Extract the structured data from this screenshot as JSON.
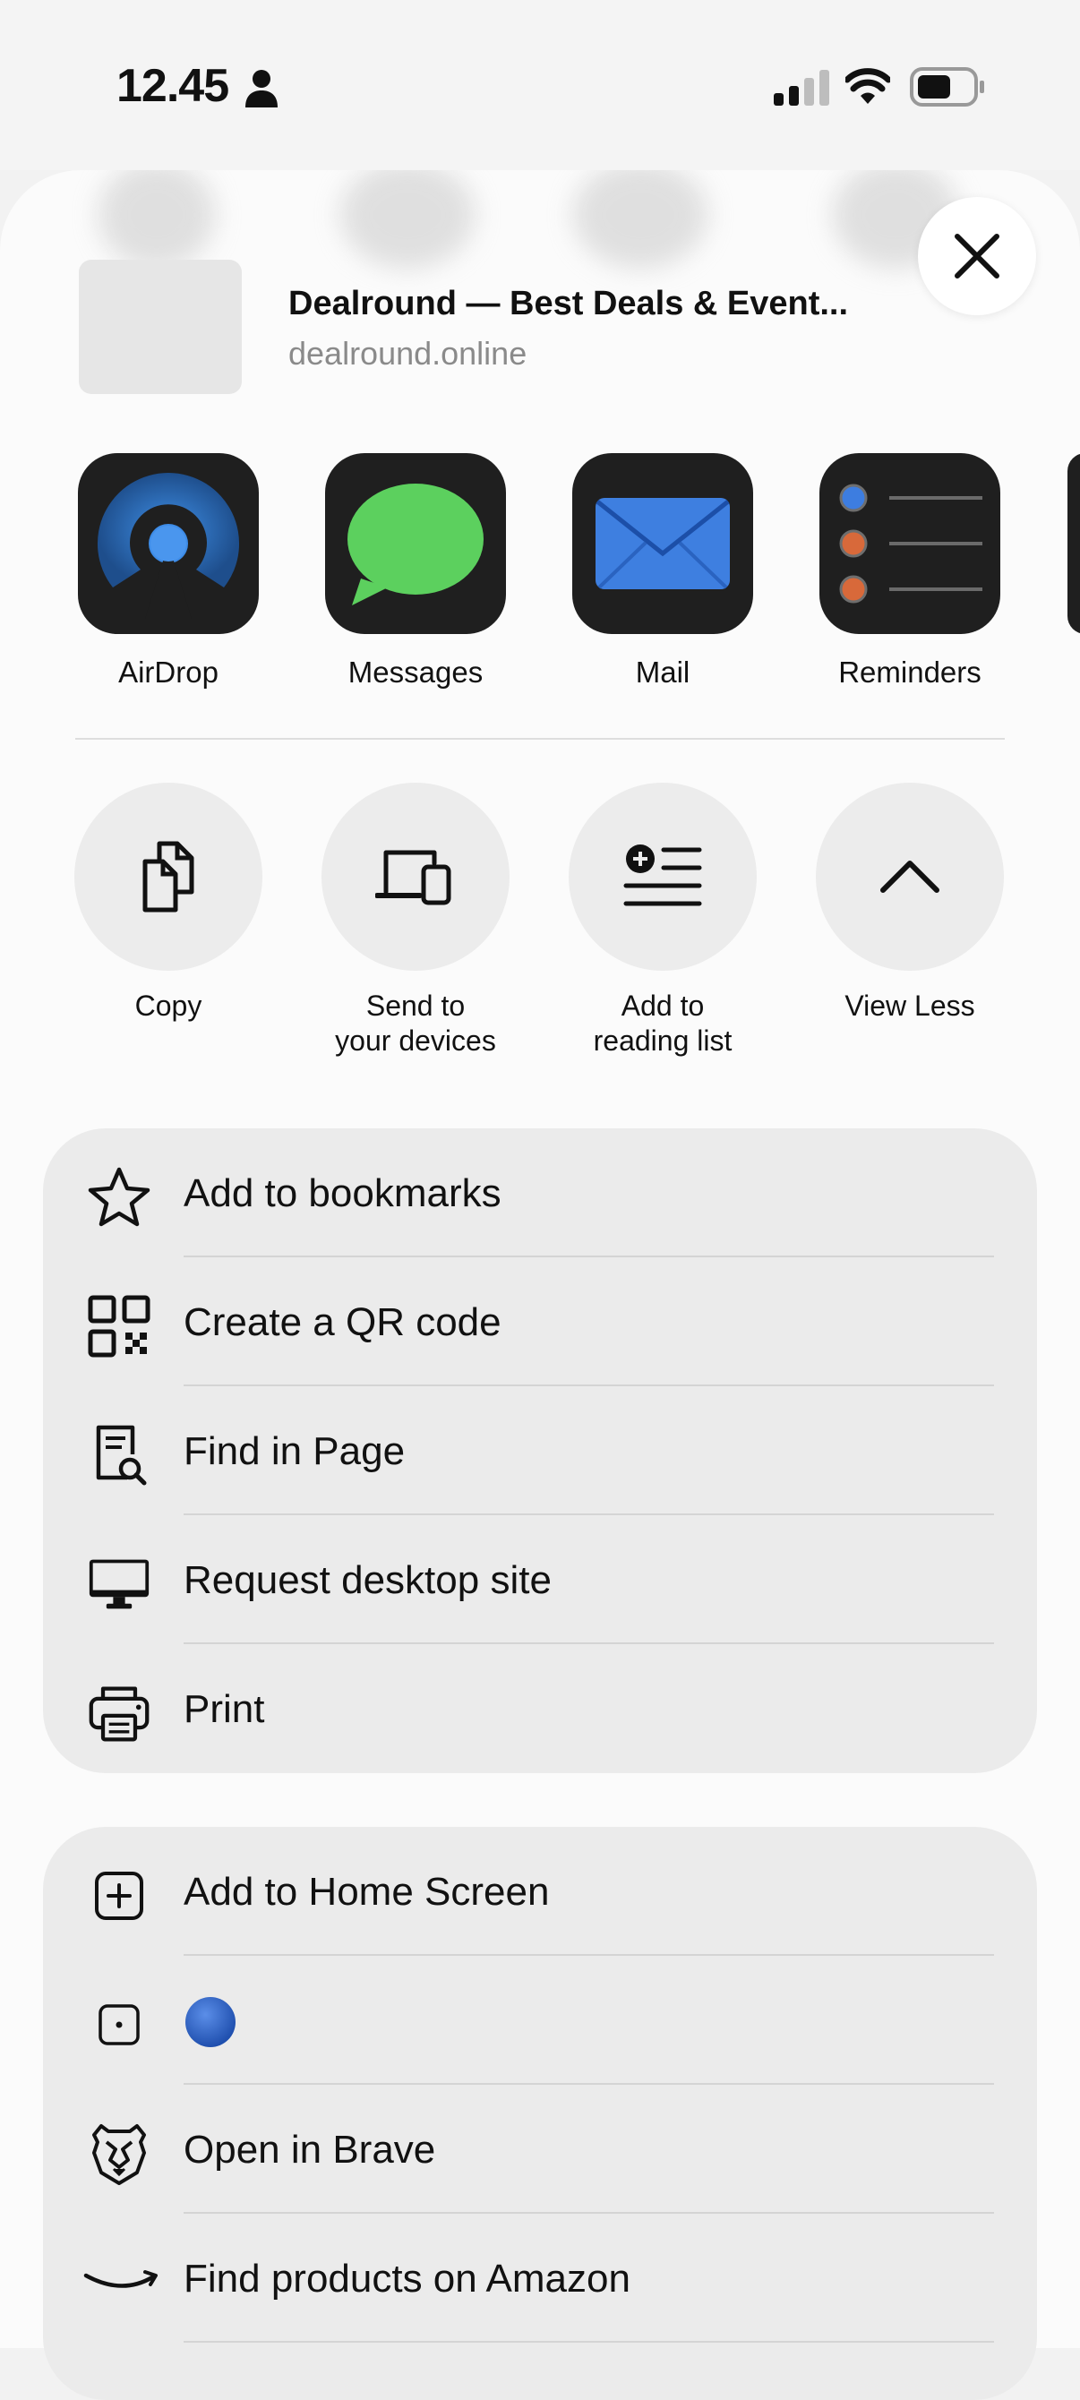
{
  "status_bar": {
    "time": "12.45"
  },
  "share_header": {
    "title": "Dealround — Best Deals & Event...",
    "url": "dealround.online"
  },
  "apps": [
    {
      "label": "AirDrop",
      "icon": "airdrop-icon"
    },
    {
      "label": "Messages",
      "icon": "messages-icon"
    },
    {
      "label": "Mail",
      "icon": "mail-icon"
    },
    {
      "label": "Reminders",
      "icon": "reminders-icon"
    }
  ],
  "actions": [
    {
      "label": "Copy",
      "icon": "copy-icon"
    },
    {
      "label": "Send to\nyour devices",
      "icon": "devices-icon"
    },
    {
      "label": "Add to\nreading list",
      "icon": "reading-list-icon"
    },
    {
      "label": "View Less",
      "icon": "chevron-up-icon"
    }
  ],
  "list1": [
    {
      "label": "Add to bookmarks",
      "icon": "star-icon"
    },
    {
      "label": "Create a QR code",
      "icon": "qr-code-icon"
    },
    {
      "label": "Find in Page",
      "icon": "find-in-page-icon"
    },
    {
      "label": "Request desktop site",
      "icon": "desktop-icon"
    },
    {
      "label": "Print",
      "icon": "printer-icon"
    }
  ],
  "list2": [
    {
      "label": "Add to Home Screen",
      "icon": "add-square-icon"
    },
    {
      "label": "",
      "icon": "dot-square-icon"
    },
    {
      "label": "Open in Brave",
      "icon": "brave-lion-icon"
    },
    {
      "label": "Find products on Amazon",
      "icon": "amazon-smile-icon"
    }
  ],
  "colors": {
    "sheet_bg": "#fbfbfb",
    "list_bg": "#ebebeb",
    "action_circle": "#ececec",
    "app_tile": "#1f1f1f",
    "blue_dot": "#2f64c8"
  }
}
